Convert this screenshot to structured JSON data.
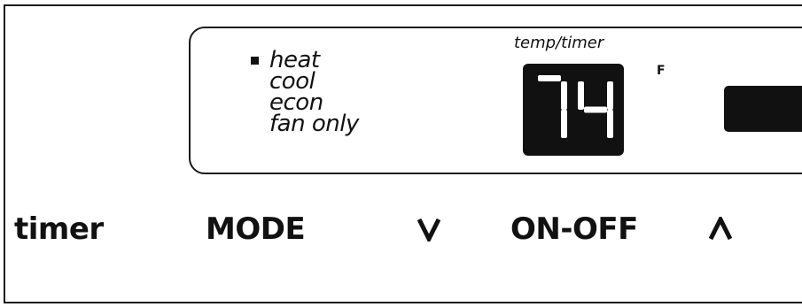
{
  "display": {
    "modes": [
      {
        "label": "heat",
        "selected": true
      },
      {
        "label": "cool",
        "selected": false
      },
      {
        "label": "econ",
        "selected": false
      },
      {
        "label": "fan only",
        "selected": false
      }
    ],
    "temp_label": "temp/timer",
    "temp_value": "74",
    "unit": "F"
  },
  "buttons": {
    "timer": "timer",
    "mode": "MODE",
    "down": "V",
    "onoff": "ON-OFF",
    "up": "Λ"
  },
  "icons": {
    "mode_indicator": "square-bullet-icon",
    "down": "chevron-down-icon",
    "up": "chevron-up-icon"
  }
}
